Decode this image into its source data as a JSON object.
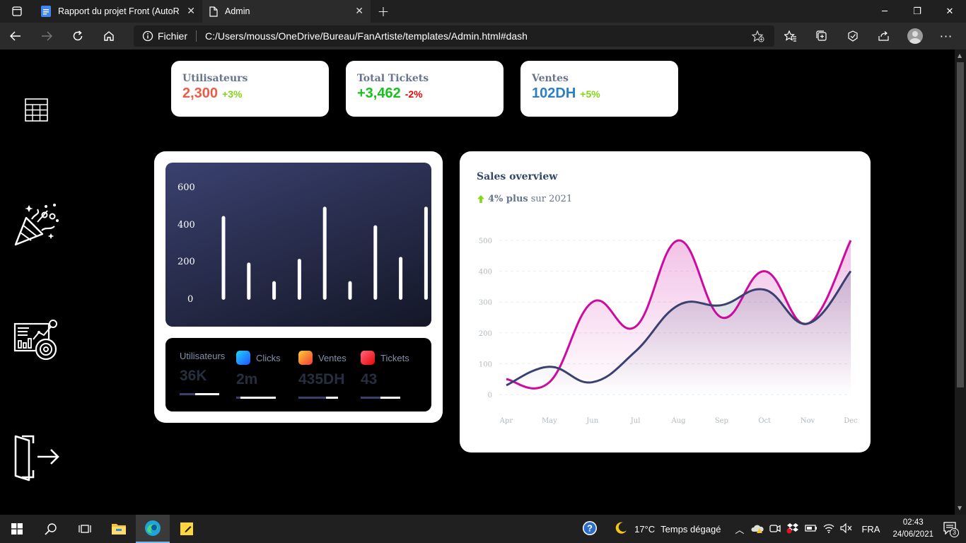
{
  "browser": {
    "tabs": [
      {
        "label": "Rapport du projet Front (AutoRe",
        "active": false
      },
      {
        "label": "Admin",
        "active": true
      }
    ],
    "address": {
      "scheme_label": "Fichier",
      "url": "C:/Users/mouss/OneDrive/Bureau/FanArtiste/templates/Admin.html#dash"
    }
  },
  "sidebar": {
    "items": [
      "table-grid-icon",
      "party-popper-icon",
      "analytics-dashboard-icon",
      "logout-door-icon"
    ]
  },
  "stats": [
    {
      "label": "Utilisateurs",
      "value": "2,300",
      "change": "+3%",
      "value_color": "#ea5c49",
      "change_color": "#82d616"
    },
    {
      "label": "Total Tickets",
      "value": "+3,462",
      "change": "-2%",
      "value_color": "#17c11e",
      "change_color": "#ea0606"
    },
    {
      "label": "Ventes",
      "value": "102DH",
      "change": "+5%",
      "value_color": "#2d7fc1",
      "change_color": "#82d616"
    }
  ],
  "bar_chart": {
    "chart_data": {
      "type": "bar",
      "categories": [
        "",
        "",
        "",
        "",
        "",
        "",
        "",
        "",
        "",
        "",
        ""
      ],
      "values": [
        450,
        200,
        100,
        220,
        500,
        100,
        400,
        230,
        500
      ],
      "yticks": [
        "600",
        "400",
        "200",
        "0"
      ],
      "ylim": [
        0,
        600
      ]
    }
  },
  "mini_stats": [
    {
      "label": "Utilisateurs",
      "value": "36K",
      "progress": 0.6,
      "icon": "",
      "color": ""
    },
    {
      "label": "Clicks",
      "value": "2m",
      "progress": 0.9,
      "icon": "clicks-icon",
      "color": "#1a73e8"
    },
    {
      "label": "Ventes",
      "value": "435DH",
      "progress": 0.3,
      "icon": "cart-icon",
      "color": "#f5803e"
    },
    {
      "label": "Tickets",
      "value": "43",
      "progress": 0.5,
      "icon": "ticket-icon",
      "color": "#ea0606"
    }
  ],
  "sales": {
    "title": "Sales overview",
    "highlight": "4% plus",
    "suffix": "sur 2021",
    "chart_data": {
      "type": "line",
      "x": [
        "Apr",
        "May",
        "Jun",
        "Jul",
        "Aug",
        "Sep",
        "Oct",
        "Nov",
        "Dec"
      ],
      "series": [
        {
          "values": [
            50,
            40,
            300,
            220,
            500,
            250,
            400,
            230,
            500
          ],
          "color": "#cb0c9f"
        },
        {
          "values": [
            30,
            90,
            40,
            140,
            290,
            290,
            340,
            230,
            400
          ],
          "color": "#3a416f"
        }
      ],
      "yticks": [
        "500",
        "400",
        "300",
        "200",
        "100",
        "0"
      ],
      "ylim": [
        0,
        500
      ],
      "grid": true
    }
  },
  "taskbar": {
    "weather": {
      "temp": "17°C",
      "desc": "Temps dégagé"
    },
    "lang": "FRA",
    "time": "02:43",
    "date": "24/06/2021",
    "notifications": "3"
  }
}
